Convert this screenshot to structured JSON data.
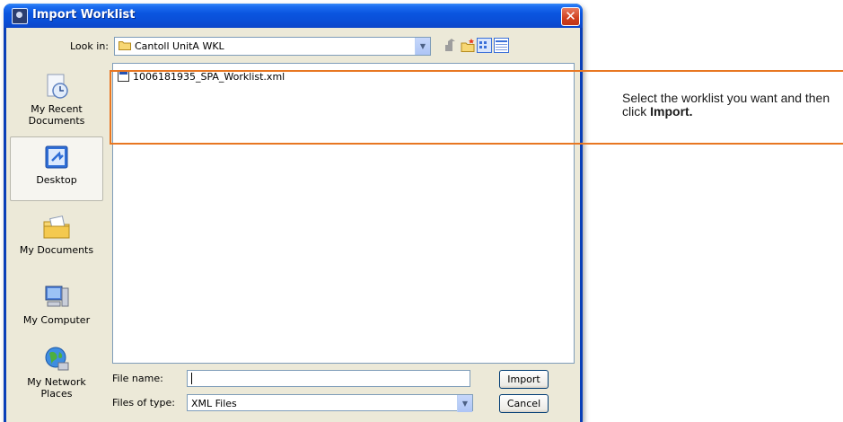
{
  "window": {
    "title": "Import Worklist"
  },
  "toolbar": {
    "look_in_label": "Look in:",
    "look_in_value": "Cantoll UnitA WKL",
    "buttons": [
      "up-one-level",
      "create-new-folder",
      "view-list",
      "view-details"
    ]
  },
  "places": [
    {
      "label": "My Recent\nDocuments",
      "icon": "recent-documents-icon"
    },
    {
      "label": "Desktop",
      "icon": "desktop-icon",
      "selected": true
    },
    {
      "label": "My Documents",
      "icon": "my-documents-icon"
    },
    {
      "label": "My Computer",
      "icon": "my-computer-icon"
    },
    {
      "label": "My Network\nPlaces",
      "icon": "network-places-icon"
    }
  ],
  "files": [
    {
      "name": "1006181935_SPA_Worklist.xml",
      "icon": "xml-file-icon"
    }
  ],
  "fields": {
    "file_name_label": "File name:",
    "file_name_value": "",
    "file_type_label": "Files of type:",
    "file_type_value": "XML Files"
  },
  "buttons": {
    "import": "Import",
    "cancel": "Cancel"
  },
  "callout": {
    "text_plain": "Select the worklist you want and then click ",
    "text_bold": "Import.",
    "color": "#e87722"
  }
}
